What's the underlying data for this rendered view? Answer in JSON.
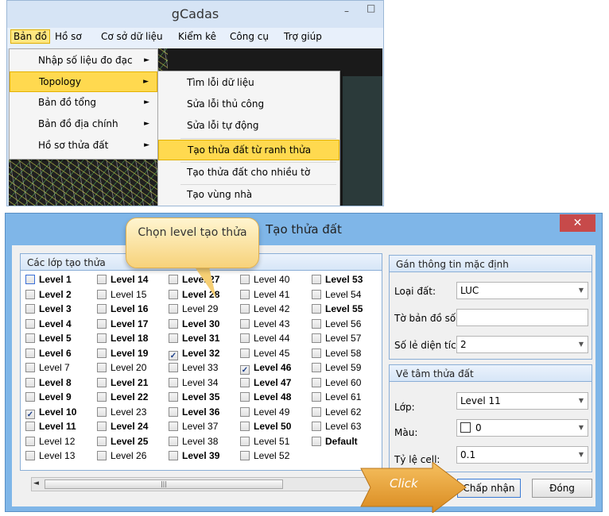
{
  "app": {
    "title": "gCadas",
    "controls": {
      "minimize": "–",
      "maximize": "□"
    },
    "menubar": [
      "Bản đồ",
      "Hồ sơ",
      "Cơ sở dữ liệu",
      "Kiểm kê",
      "Công cụ",
      "Trợ giúp"
    ],
    "menu_bando": [
      "Nhập số liệu đo đạc",
      "Topology",
      "Bản đồ tổng",
      "Bản đồ địa chính",
      "Hồ sơ thửa đất"
    ],
    "menu_topology": [
      "Tìm lỗi dữ liệu",
      "Sửa lỗi thủ công",
      "Sửa lỗi tự động",
      "Tạo thửa đất từ ranh thửa",
      "Tạo thửa đất cho nhiều tờ",
      "Tạo vùng nhà"
    ],
    "submenu_arrow": "►"
  },
  "dialog": {
    "title": "Tạo thửa đất",
    "close_icon": "✕",
    "group_levels_title": "Các lớp tạo thửa",
    "levels": [
      {
        "label": "Level 1",
        "bold": true,
        "checked": false
      },
      {
        "label": "Level 2",
        "bold": true,
        "checked": false
      },
      {
        "label": "Level 3",
        "bold": true,
        "checked": false
      },
      {
        "label": "Level 4",
        "bold": true,
        "checked": false
      },
      {
        "label": "Level 5",
        "bold": true,
        "checked": false
      },
      {
        "label": "Level 6",
        "bold": true,
        "checked": false
      },
      {
        "label": "Level 7",
        "bold": false,
        "checked": false
      },
      {
        "label": "Level 8",
        "bold": true,
        "checked": false
      },
      {
        "label": "Level 9",
        "bold": true,
        "checked": false
      },
      {
        "label": "Level 10",
        "bold": true,
        "checked": true
      },
      {
        "label": "Level 11",
        "bold": true,
        "checked": false
      },
      {
        "label": "Level 12",
        "bold": false,
        "checked": false
      },
      {
        "label": "Level 13",
        "bold": false,
        "checked": false
      },
      {
        "label": "Level 14",
        "bold": true,
        "checked": false
      },
      {
        "label": "Level 15",
        "bold": false,
        "checked": false
      },
      {
        "label": "Level 16",
        "bold": true,
        "checked": false
      },
      {
        "label": "Level 17",
        "bold": true,
        "checked": false
      },
      {
        "label": "Level 18",
        "bold": true,
        "checked": false
      },
      {
        "label": "Level 19",
        "bold": true,
        "checked": false
      },
      {
        "label": "Level 20",
        "bold": false,
        "checked": false
      },
      {
        "label": "Level 21",
        "bold": true,
        "checked": false
      },
      {
        "label": "Level 22",
        "bold": true,
        "checked": false
      },
      {
        "label": "Level 23",
        "bold": false,
        "checked": false
      },
      {
        "label": "Level 24",
        "bold": true,
        "checked": false
      },
      {
        "label": "Level 25",
        "bold": true,
        "checked": false
      },
      {
        "label": "Level 26",
        "bold": false,
        "checked": false
      },
      {
        "label": "Level 27",
        "bold": true,
        "checked": false
      },
      {
        "label": "Level 28",
        "bold": true,
        "checked": false
      },
      {
        "label": "Level 29",
        "bold": false,
        "checked": false
      },
      {
        "label": "Level 30",
        "bold": true,
        "checked": false
      },
      {
        "label": "Level 31",
        "bold": true,
        "checked": false
      },
      {
        "label": "Level 32",
        "bold": true,
        "checked": true
      },
      {
        "label": "Level 33",
        "bold": false,
        "checked": false
      },
      {
        "label": "Level 34",
        "bold": false,
        "checked": false
      },
      {
        "label": "Level 35",
        "bold": true,
        "checked": false
      },
      {
        "label": "Level 36",
        "bold": true,
        "checked": false
      },
      {
        "label": "Level 37",
        "bold": false,
        "checked": false
      },
      {
        "label": "Level 38",
        "bold": false,
        "checked": false
      },
      {
        "label": "Level 39",
        "bold": true,
        "checked": false
      },
      {
        "label": "Level 40",
        "bold": false,
        "checked": false
      },
      {
        "label": "Level 41",
        "bold": false,
        "checked": false
      },
      {
        "label": "Level 42",
        "bold": false,
        "checked": false
      },
      {
        "label": "Level 43",
        "bold": false,
        "checked": false
      },
      {
        "label": "Level 44",
        "bold": false,
        "checked": false
      },
      {
        "label": "Level 45",
        "bold": false,
        "checked": false
      },
      {
        "label": "Level 46",
        "bold": true,
        "checked": true
      },
      {
        "label": "Level 47",
        "bold": true,
        "checked": false
      },
      {
        "label": "Level 48",
        "bold": true,
        "checked": false
      },
      {
        "label": "Level 49",
        "bold": false,
        "checked": false
      },
      {
        "label": "Level 50",
        "bold": true,
        "checked": false
      },
      {
        "label": "Level 51",
        "bold": false,
        "checked": false
      },
      {
        "label": "Level 52",
        "bold": false,
        "checked": false
      },
      {
        "label": "Level 53",
        "bold": true,
        "checked": false
      },
      {
        "label": "Level 54",
        "bold": false,
        "checked": false
      },
      {
        "label": "Level 55",
        "bold": true,
        "checked": false
      },
      {
        "label": "Level 56",
        "bold": false,
        "checked": false
      },
      {
        "label": "Level 57",
        "bold": false,
        "checked": false
      },
      {
        "label": "Level 58",
        "bold": false,
        "checked": false
      },
      {
        "label": "Level 59",
        "bold": false,
        "checked": false
      },
      {
        "label": "Level 60",
        "bold": false,
        "checked": false
      },
      {
        "label": "Level 61",
        "bold": false,
        "checked": false
      },
      {
        "label": "Level 62",
        "bold": false,
        "checked": false
      },
      {
        "label": "Level 63",
        "bold": false,
        "checked": false
      },
      {
        "label": "Default",
        "bold": true,
        "checked": false
      }
    ],
    "check_mark": "✓",
    "scroll_left_icon": "◄",
    "scroll_thumb_grip": "|||",
    "defaults": {
      "title": "Gán thông tin mặc định",
      "land_type_label": "Loại đất:",
      "land_type_value": "LUC",
      "map_sheet_label": "Tờ bản đồ số:",
      "map_sheet_value": "",
      "area_decimals_label": "Số lẻ diện tích:",
      "area_decimals_value": "2",
      "dropdown_icon": "▼"
    },
    "center": {
      "title": "Vẽ tâm thửa đất",
      "layer_label": "Lớp:",
      "layer_value": "Level 11",
      "color_label": "Màu:",
      "color_value": "0",
      "scale_label": "Tỷ lệ cell:",
      "scale_value": "0.1"
    },
    "ok_label": "Chấp nhận",
    "close_label": "Đóng"
  },
  "callouts": {
    "bubble_text": "Chọn level tạo thửa",
    "click_text": "Click"
  },
  "colors": {
    "dialog_frame": "#7fb6e8",
    "menu_highlight": "#ffd94f",
    "close_red": "#c74a4a",
    "callout": "#f7d27a"
  }
}
